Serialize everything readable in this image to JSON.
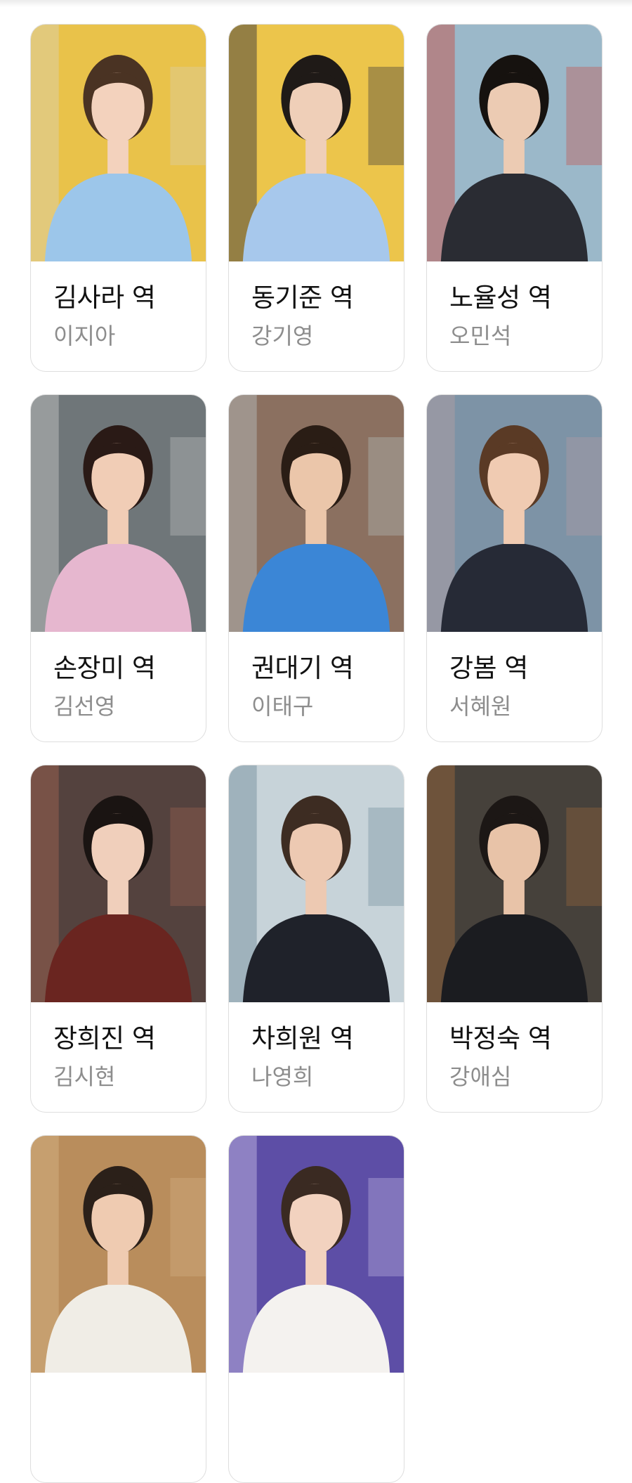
{
  "cast": [
    {
      "role": "김사라 역",
      "actor": "이지아",
      "bg": "#e9c24a",
      "shirt": "#9cc6ea",
      "hair": "#4a3323",
      "skin": "#f3d2bd",
      "accent": "#d9d2b8"
    },
    {
      "role": "동기준 역",
      "actor": "강기영",
      "bg": "#ecc54b",
      "shirt": "#a7c8ec",
      "hair": "#1f1a17",
      "skin": "#efcfb8",
      "accent": "#2b2b3b"
    },
    {
      "role": "노율성 역",
      "actor": "오민석",
      "bg": "#9bb8c9",
      "shirt": "#2a2c33",
      "hair": "#16120f",
      "skin": "#eccbb3",
      "accent": "#c9493e"
    },
    {
      "role": "손장미 역",
      "actor": "김선영",
      "bg": "#6f7679",
      "shirt": "#e6b7cf",
      "hair": "#2a1a16",
      "skin": "#f1cdb6",
      "accent": "#c7c9c8"
    },
    {
      "role": "권대기 역",
      "actor": "이태구",
      "bg": "#8b7060",
      "shirt": "#3b86d6",
      "hair": "#2a1d15",
      "skin": "#ebc6aa",
      "accent": "#b7c2c3"
    },
    {
      "role": "강봄 역",
      "actor": "서혜원",
      "bg": "#7d93a6",
      "shirt": "#262a36",
      "hair": "#5a3a25",
      "skin": "#f0cbb2",
      "accent": "#b69fa2"
    },
    {
      "role": "장희진 역",
      "actor": "김시현",
      "bg": "#54423e",
      "shirt": "#6a2520",
      "hair": "#1a1412",
      "skin": "#f0cfbb",
      "accent": "#a36552"
    },
    {
      "role": "차희원 역",
      "actor": "나영희",
      "bg": "#c7d3d9",
      "shirt": "#1f222a",
      "hair": "#3d2c22",
      "skin": "#edc9b2",
      "accent": "#6e8a98"
    },
    {
      "role": "박정숙 역",
      "actor": "강애심",
      "bg": "#46413b",
      "shirt": "#1b1c20",
      "hair": "#1c1715",
      "skin": "#e8c3a8",
      "accent": "#a06a3c"
    },
    {
      "role": "",
      "actor": "",
      "bg": "#b98d5c",
      "shirt": "#f0ede6",
      "hair": "#2b2019",
      "skin": "#efcbb1",
      "accent": "#d7b588"
    },
    {
      "role": "",
      "actor": "",
      "bg": "#5d4ea6",
      "shirt": "#f4f2ef",
      "hair": "#3a2a22",
      "skin": "#f2d2bf",
      "accent": "#c9c1e6"
    }
  ]
}
